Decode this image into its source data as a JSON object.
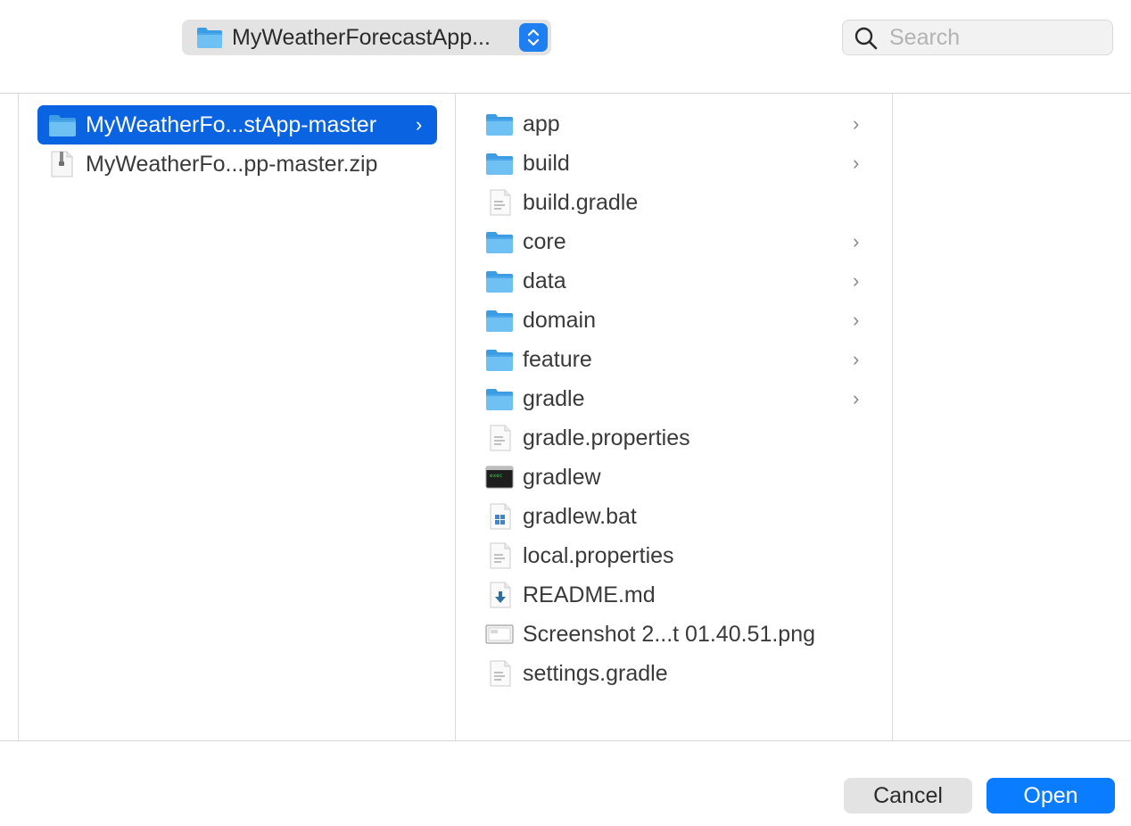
{
  "toolbar": {
    "path_popup_label": "MyWeatherForecastApp...",
    "path_popup_icon": "folder-icon",
    "search_placeholder": "Search",
    "search_value": ""
  },
  "column1": {
    "items": [
      {
        "name": "MyWeatherFo...stApp-master",
        "icon": "folder-icon",
        "selected": true,
        "has_children": true
      },
      {
        "name": "MyWeatherFo...pp-master.zip",
        "icon": "zip-file-icon",
        "selected": false,
        "has_children": false
      }
    ]
  },
  "column2": {
    "items": [
      {
        "name": "app",
        "icon": "folder-icon",
        "has_children": true
      },
      {
        "name": "build",
        "icon": "folder-icon",
        "has_children": true
      },
      {
        "name": "build.gradle",
        "icon": "text-file-icon",
        "has_children": false
      },
      {
        "name": "core",
        "icon": "folder-icon",
        "has_children": true
      },
      {
        "name": "data",
        "icon": "folder-icon",
        "has_children": true
      },
      {
        "name": "domain",
        "icon": "folder-icon",
        "has_children": true
      },
      {
        "name": "feature",
        "icon": "folder-icon",
        "has_children": true
      },
      {
        "name": "gradle",
        "icon": "folder-icon",
        "has_children": true
      },
      {
        "name": "gradle.properties",
        "icon": "text-file-icon",
        "has_children": false
      },
      {
        "name": "gradlew",
        "icon": "terminal-executable-icon",
        "has_children": false
      },
      {
        "name": "gradlew.bat",
        "icon": "windows-batch-file-icon",
        "has_children": false
      },
      {
        "name": "local.properties",
        "icon": "text-file-icon",
        "has_children": false
      },
      {
        "name": "README.md",
        "icon": "markdown-file-icon",
        "has_children": false
      },
      {
        "name": "Screenshot 2...t 01.40.51.png",
        "icon": "image-file-icon",
        "has_children": false
      },
      {
        "name": "settings.gradle",
        "icon": "text-file-icon",
        "has_children": false
      }
    ]
  },
  "chevron_glyph": "›",
  "footer": {
    "cancel_label": "Cancel",
    "open_label": "Open"
  },
  "colors": {
    "selection": "#0a63e0",
    "primary_button": "#0a7cff",
    "folder": "#5fb7f0"
  }
}
